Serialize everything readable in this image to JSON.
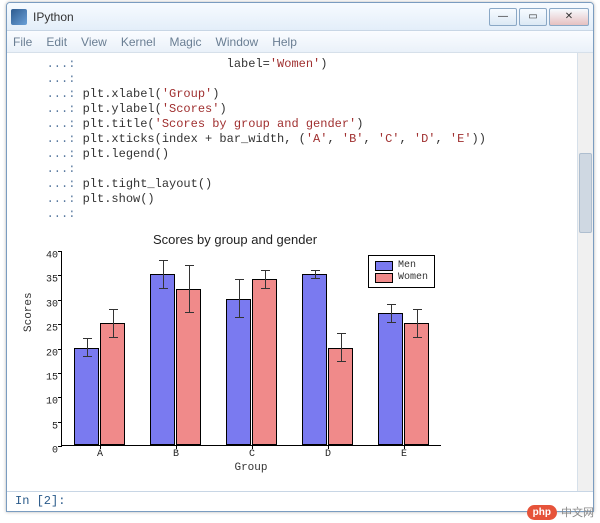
{
  "window": {
    "title": "IPython",
    "buttons": {
      "min": "—",
      "max": "▭",
      "close": "✕"
    }
  },
  "menu": {
    "items": [
      "File",
      "Edit",
      "View",
      "Kernel",
      "Magic",
      "Window",
      "Help"
    ]
  },
  "code": {
    "prompt": "   ...: ",
    "lines": [
      "                    label='Women')",
      "",
      "plt.xlabel('Group')",
      "plt.ylabel('Scores')",
      "plt.title('Scores by group and gender')",
      "plt.xticks(index + bar_width, ('A', 'B', 'C', 'D', 'E'))",
      "plt.legend()",
      "",
      "plt.tight_layout()",
      "plt.show()",
      ""
    ]
  },
  "status": {
    "prompt": "In [2]:"
  },
  "watermark": {
    "brand": "php",
    "cn": "中文网"
  },
  "chart_data": {
    "type": "bar",
    "title": "Scores by group and gender",
    "xlabel": "Group",
    "ylabel": "Scores",
    "categories": [
      "A",
      "B",
      "C",
      "D",
      "E"
    ],
    "series": [
      {
        "name": "Men",
        "values": [
          20,
          35,
          30,
          35,
          27
        ],
        "errors": [
          2,
          3,
          4,
          1,
          2
        ],
        "color": "#7a7af0"
      },
      {
        "name": "Women",
        "values": [
          25,
          32,
          34,
          20,
          25
        ],
        "errors": [
          3,
          5,
          2,
          3,
          3
        ],
        "color": "#f08a8a"
      }
    ],
    "ylim": [
      0,
      40
    ],
    "yticks": [
      0,
      5,
      10,
      15,
      20,
      25,
      30,
      35,
      40
    ],
    "legend_pos": "upper right"
  }
}
